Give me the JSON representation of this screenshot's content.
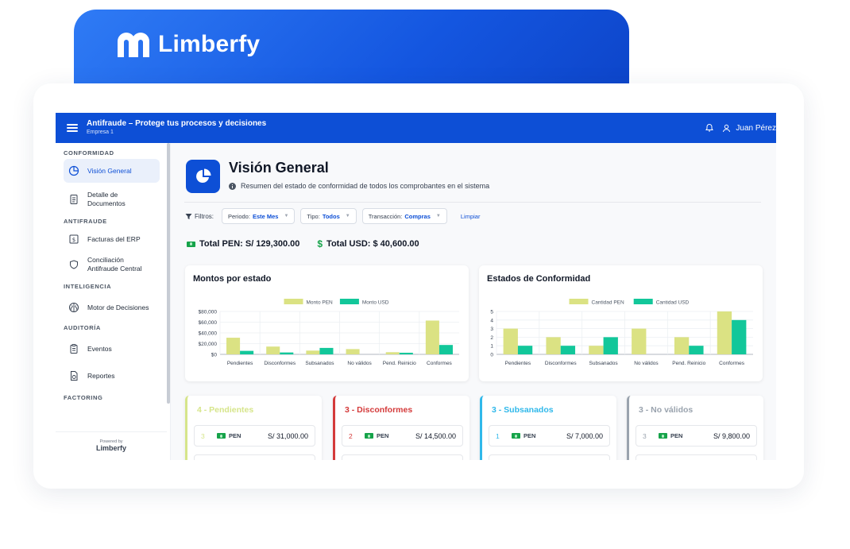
{
  "brand": {
    "name": "Limberfy"
  },
  "topbar": {
    "title": "Antifraude – Protege tus procesos y decisiones",
    "company": "Empresa 1",
    "user": "Juan Pérez"
  },
  "sidebar": {
    "sections": [
      {
        "label": "CONFORMIDAD"
      },
      {
        "label": "ANTIFRAUDE"
      },
      {
        "label": "INTELIGENCIA"
      },
      {
        "label": "AUDITORÍA"
      },
      {
        "label": "FACTORING"
      }
    ],
    "items": [
      {
        "label": "Visión General"
      },
      {
        "label": "Detalle de Documentos"
      },
      {
        "label": "Facturas del ERP"
      },
      {
        "label": "Conciliación Antifraude Central"
      },
      {
        "label": "Motor de Decisiones"
      },
      {
        "label": "Eventos"
      },
      {
        "label": "Reportes"
      }
    ],
    "powered_by": "Powered by",
    "powered_logo": "Limberfy"
  },
  "header": {
    "title": "Visión General",
    "subtitle": "Resumen del estado de conformidad de todos los comprobantes en el sistema"
  },
  "filters": {
    "label": "Filtros:",
    "periodo_label": "Periodo:",
    "periodo_value": "Este Mes",
    "tipo_label": "Tipo:",
    "tipo_value": "Todos",
    "transaccion_label": "Transacción:",
    "transaccion_value": "Compras",
    "clear": "Limpiar"
  },
  "totals": {
    "pen": "Total PEN:  S/ 129,300.00",
    "usd": "Total USD:  $ 40,600.00"
  },
  "colors": {
    "primary": "#0d4fd6",
    "series_a": "#dbe283",
    "series_b": "#12c79a"
  },
  "chart_data": [
    {
      "type": "bar",
      "title": "Montos por estado",
      "categories": [
        "Pendientes",
        "Disconformes",
        "Subsanados",
        "No válidos",
        "Pend. Reinicio",
        "Conformes"
      ],
      "series": [
        {
          "name": "Monto PEN",
          "values": [
            31000,
            14500,
            7000,
            9800,
            4000,
            63000
          ]
        },
        {
          "name": "Monto USD",
          "values": [
            6500,
            3500,
            12000,
            0,
            3000,
            17500
          ]
        }
      ],
      "yticks": [
        "$0",
        "$20,000",
        "$40,000",
        "$60,000",
        "$80,000"
      ],
      "ylim": [
        0,
        80000
      ]
    },
    {
      "type": "bar",
      "title": "Estados de Conformidad",
      "categories": [
        "Pendientes",
        "Disconformes",
        "Subsanados",
        "No válidos",
        "Pend. Reinicio",
        "Conformes"
      ],
      "series": [
        {
          "name": "Cantidad PEN",
          "values": [
            3,
            2,
            1,
            3,
            2,
            5
          ]
        },
        {
          "name": "Cantidad USD",
          "values": [
            1,
            1,
            2,
            0,
            1,
            4
          ]
        }
      ],
      "yticks": [
        "0",
        "1",
        "2",
        "3",
        "4",
        "5"
      ],
      "ylim": [
        0,
        5
      ]
    }
  ],
  "status_cards": [
    {
      "title": "4 - Pendientes",
      "color": "#d6e58a",
      "count": "3",
      "currency": "PEN",
      "amount": "S/ 31,000.00"
    },
    {
      "title": "3 - Disconformes",
      "color": "#d43a3a",
      "count": "2",
      "currency": "PEN",
      "amount": "S/ 14,500.00"
    },
    {
      "title": "3 - Subsanados",
      "color": "#2fb8ea",
      "count": "1",
      "currency": "PEN",
      "amount": "S/ 7,000.00"
    },
    {
      "title": "3 - No válidos",
      "color": "#9aa3ae",
      "count": "3",
      "currency": "PEN",
      "amount": "S/ 9,800.00"
    }
  ]
}
